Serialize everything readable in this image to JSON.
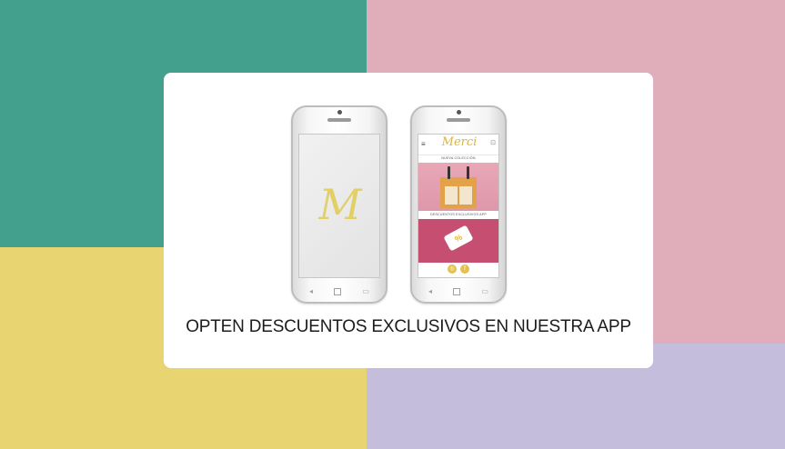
{
  "caption": "OPTEN DESCUENTOS EXCLUSIVOS EN NUESTRA APP",
  "phones": {
    "left": {
      "monogram": "M"
    },
    "right": {
      "brand": "Merci",
      "brand_sub": "",
      "section1_label": "NUEVA COLECCIÓN",
      "section2_label": "DESCUENTOS EXCLUSIVOS APP",
      "tag_symbol": "%",
      "icons": [
        "instagram-icon",
        "facebook-icon"
      ]
    }
  },
  "colors": {
    "teal": "#43a08d",
    "pink": "#e0aebb",
    "yellow": "#e8d470",
    "lavender": "#c5bddc",
    "magenta": "#c64e71",
    "gold": "#d9b642"
  }
}
